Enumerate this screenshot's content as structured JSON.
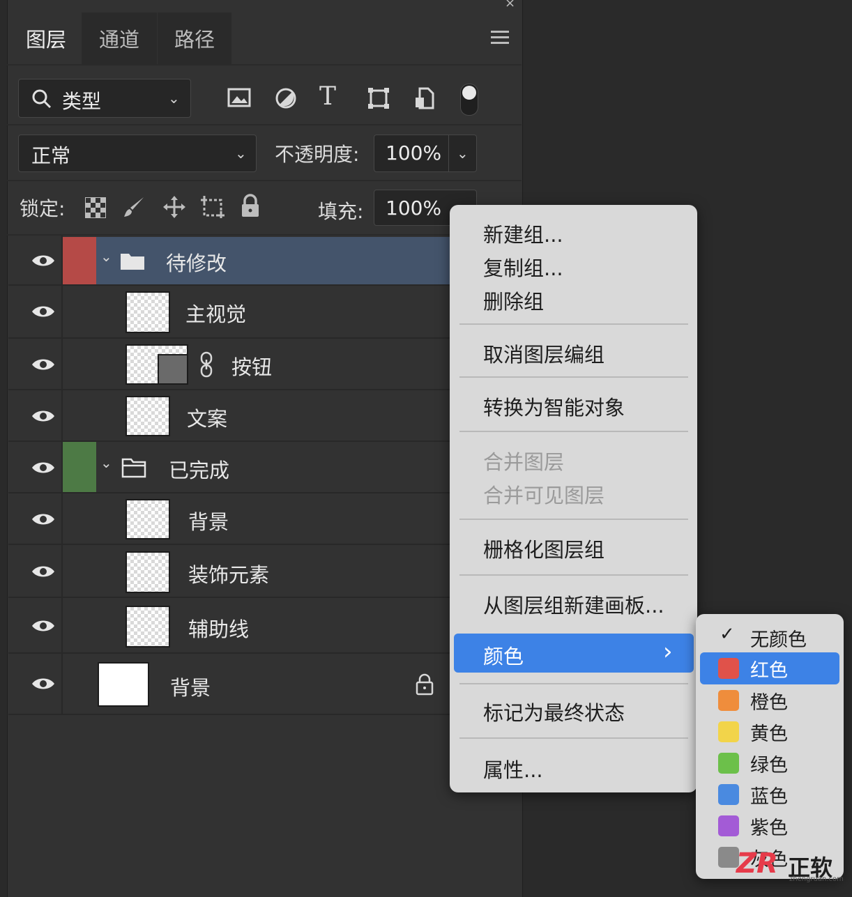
{
  "panel": {
    "tabs": [
      {
        "label": "图层"
      },
      {
        "label": "通道"
      },
      {
        "label": "路径"
      }
    ],
    "filter": {
      "label": "类型"
    },
    "blend_mode": "正常",
    "opacity": {
      "label": "不透明度:",
      "value": "100%"
    },
    "lock": {
      "label": "锁定:"
    },
    "fill": {
      "label": "填充:",
      "value": "100%"
    },
    "layers": [
      {
        "name": "待修改",
        "type": "group",
        "color": "#b54a47"
      },
      {
        "name": "主视觉",
        "type": "layer"
      },
      {
        "name": "按钮",
        "type": "layer-mask"
      },
      {
        "name": "文案",
        "type": "layer"
      },
      {
        "name": "已完成",
        "type": "group",
        "color": "#4d7a45"
      },
      {
        "name": "背景",
        "type": "layer"
      },
      {
        "name": "装饰元素",
        "type": "layer"
      },
      {
        "name": "辅助线",
        "type": "layer"
      },
      {
        "name": "背景",
        "type": "background",
        "locked": true
      }
    ]
  },
  "context_menu": {
    "items": [
      {
        "label": "新建组..."
      },
      {
        "label": "复制组..."
      },
      {
        "label": "删除组"
      },
      {
        "label": "取消图层编组"
      },
      {
        "label": "转换为智能对象"
      },
      {
        "label": "合并图层",
        "disabled": true
      },
      {
        "label": "合并可见图层",
        "disabled": true
      },
      {
        "label": "栅格化图层组"
      },
      {
        "label": "从图层组新建画板..."
      },
      {
        "label": "颜色",
        "highlighted": true
      },
      {
        "label": "标记为最终状态"
      },
      {
        "label": "属性..."
      }
    ]
  },
  "color_submenu": {
    "items": [
      {
        "label": "无颜色",
        "checked": true
      },
      {
        "label": "红色",
        "color": "#e0524a",
        "highlighted": true
      },
      {
        "label": "橙色",
        "color": "#ef8d3c"
      },
      {
        "label": "黄色",
        "color": "#f2d44a"
      },
      {
        "label": "绿色",
        "color": "#6cc04a"
      },
      {
        "label": "蓝色",
        "color": "#4a8ae0"
      },
      {
        "label": "紫色",
        "color": "#a35bd6"
      },
      {
        "label": "灰色",
        "color": "#8a8a8a"
      }
    ]
  },
  "watermark": {
    "text": "正软",
    "url": "zhengruan.com"
  },
  "colors": {
    "panel_bg": "#323232",
    "selected_row": "#44546b",
    "menu_highlight": "#3d82e6"
  }
}
